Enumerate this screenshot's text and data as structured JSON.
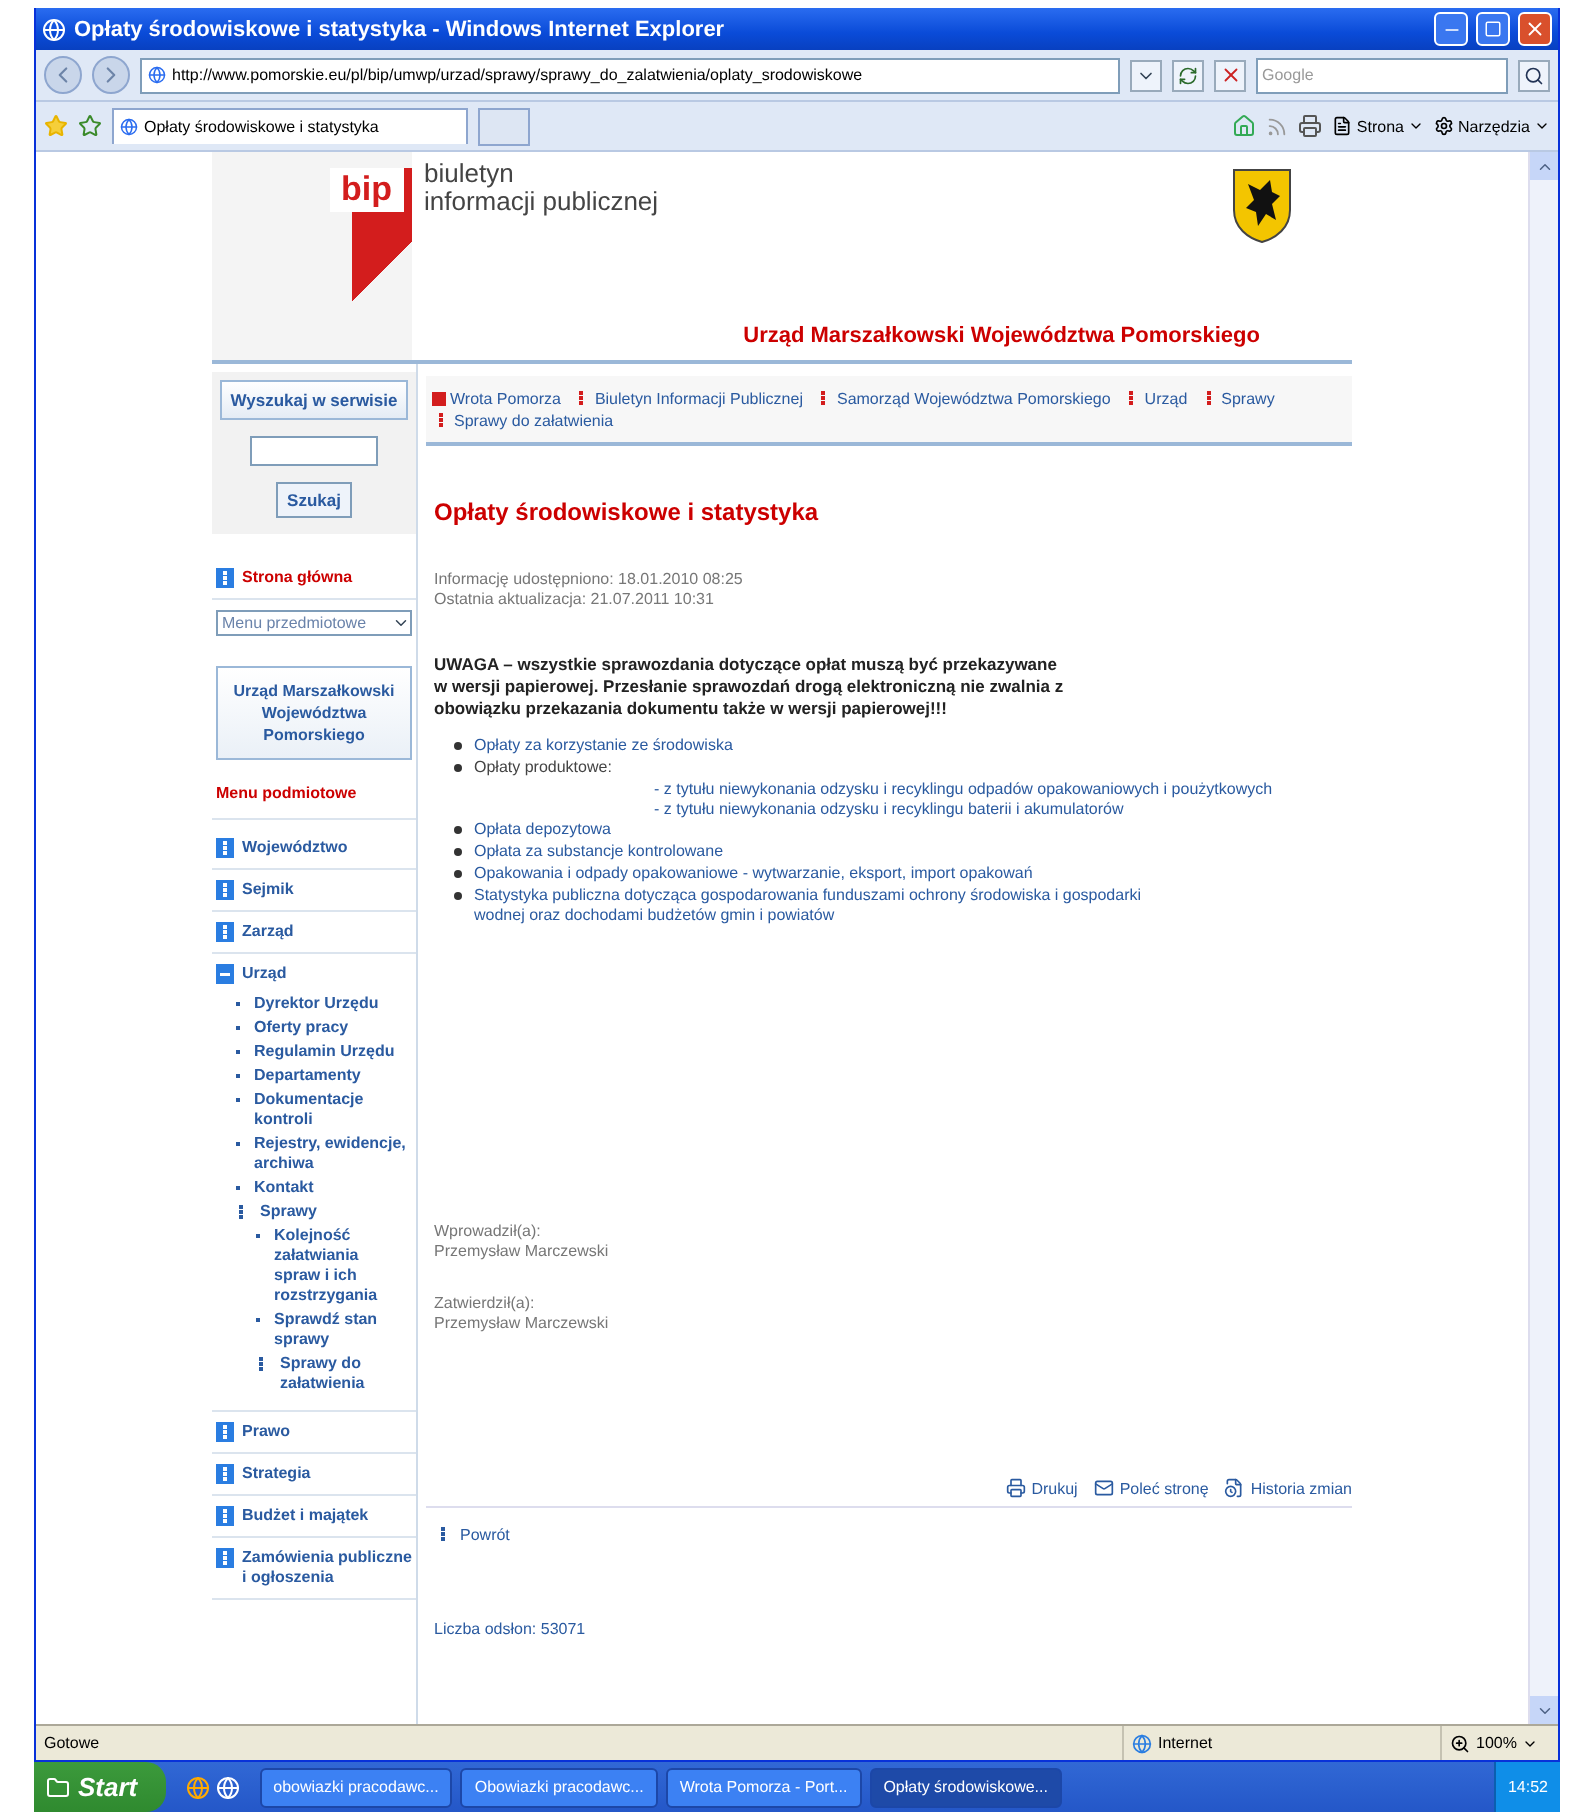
{
  "window": {
    "title": "Opłaty środowiskowe i statystyka - Windows Internet Explorer"
  },
  "address_bar": {
    "url": "http://www.pomorskie.eu/pl/bip/umwp/urzad/sprawy/sprawy_do_zalatwienia/oplaty_srodowiskowe"
  },
  "search": {
    "placeholder": "Google"
  },
  "tab": {
    "label": "Opłaty środowiskowe i statystyka",
    "selected": true
  },
  "command_bar": [
    "Strona",
    "Narzędzia"
  ],
  "header": {
    "logo": "bip",
    "logo_lines": [
      "biuletyn",
      "informacji publicznej"
    ],
    "institution": "Urząd Marszałkowski Województwa Pomorskiego"
  },
  "sidebar": {
    "search_title": "Wyszukaj w serwisie",
    "search_button": "Szukaj",
    "home": "Strona główna",
    "subject_select": "Menu przedmiotowe",
    "institution_box": "Urząd Marszałkowski Województwa Pomorskiego",
    "menu_title": "Menu podmiotowe",
    "items": [
      {
        "label": "Województwo",
        "expanded": false
      },
      {
        "label": "Sejmik",
        "expanded": false
      },
      {
        "label": "Zarząd",
        "expanded": false
      },
      {
        "label": "Urząd",
        "expanded": true,
        "children": [
          {
            "label": "Dyrektor Urzędu",
            "kind": "leaf"
          },
          {
            "label": "Oferty pracy",
            "kind": "leaf"
          },
          {
            "label": "Regulamin Urzędu",
            "kind": "leaf"
          },
          {
            "label": "Departamenty",
            "kind": "leaf"
          },
          {
            "label": "Dokumentacje kontroli",
            "kind": "leaf"
          },
          {
            "label": "Rejestry, ewidencje, archiwa",
            "kind": "leaf"
          },
          {
            "label": "Kontakt",
            "kind": "leaf"
          },
          {
            "label": "Sprawy",
            "kind": "branch",
            "children": [
              {
                "label": "Kolejność załatwiania spraw i ich rozstrzygania",
                "kind": "leaf"
              },
              {
                "label": "Sprawdź stan sprawy",
                "kind": "leaf"
              },
              {
                "label": "Sprawy do załatwienia",
                "kind": "branch"
              }
            ]
          }
        ]
      },
      {
        "label": "Prawo",
        "expanded": false
      },
      {
        "label": "Strategia",
        "expanded": false
      },
      {
        "label": "Budżet i majątek",
        "expanded": false
      },
      {
        "label": "Zamówienia publiczne i ogłoszenia",
        "expanded": false
      }
    ]
  },
  "breadcrumbs": [
    "Wrota Pomorza",
    "Biuletyn Informacji Publicznej",
    "Samorząd Województwa Pomorskiego",
    "Urząd",
    "Sprawy",
    "Sprawy do załatwienia"
  ],
  "article": {
    "title": "Opłaty środowiskowe i statystyka",
    "published": "Informację udostępniono: 18.01.2010 08:25",
    "updated": "Ostatnia aktualizacja: 21.07.2011 10:31",
    "warning": "UWAGA – wszystkie sprawozdania dotyczące opłat muszą być przekazywane w wersji papierowej. Przesłanie sprawozdań drogą elektroniczną nie zwalnia z obowiązku przekazania dokumentu także w wersji papierowej!!!",
    "list": [
      {
        "label": "Opłaty za korzystanie ze środowiska",
        "kind": "link"
      },
      {
        "label": "Opłaty produktowe:",
        "kind": "plain",
        "children": [
          "- z tytułu niewykonania odzysku i recyklingu odpadów opakowaniowych i poużytkowych",
          "- z tytułu niewykonania odzysku i recyklingu baterii i akumulatorów"
        ]
      },
      {
        "label": "Opłata depozytowa",
        "kind": "link"
      },
      {
        "label": "Opłata za substancje kontrolowane",
        "kind": "link"
      },
      {
        "label": "Opakowania i odpady opakowaniowe - wytwarzanie, eksport, import opakowań",
        "kind": "link"
      },
      {
        "label": "Statystyka publiczna dotycząca gospodarowania funduszami ochrony środowiska i gospodarki wodnej oraz dochodami budżetów gmin i powiatów",
        "kind": "link"
      }
    ],
    "introduced_label": "Wprowadził(a):",
    "introduced_by": "Przemysław Marczewski",
    "approved_label": "Zatwierdził(a):",
    "approved_by": "Przemysław Marczewski",
    "actions": [
      "Drukuj",
      "Poleć stronę",
      "Historia zmian"
    ],
    "back": "Powrót",
    "views": "Liczba odsłon: 53071"
  },
  "status_bar": {
    "text": "Gotowe",
    "zone": "Internet",
    "zoom": "100%"
  },
  "taskbar": {
    "start": "Start",
    "tasks": [
      {
        "label": "obowiazki pracodawc...",
        "selected": false
      },
      {
        "label": "Obowiazki pracodawc...",
        "selected": false
      },
      {
        "label": "Wrota Pomorza - Port...",
        "selected": false
      },
      {
        "label": "Opłaty środowiskowe...",
        "selected": true
      }
    ],
    "clock": "14:52"
  }
}
